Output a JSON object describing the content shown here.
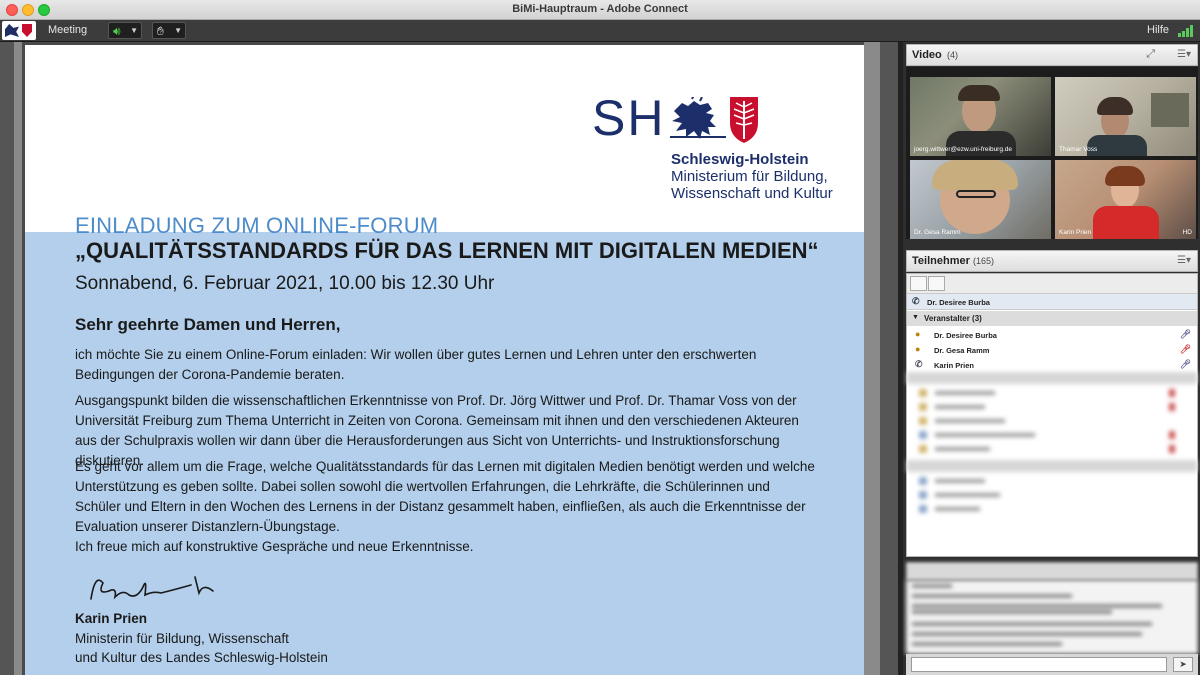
{
  "window": {
    "title": "BiMi-Hauptraum - Adobe Connect"
  },
  "toolbar": {
    "meeting_label": "Meeting",
    "help_label": "Hilfe"
  },
  "document": {
    "logo_text": "SH",
    "state_name": "Schleswig-Holstein",
    "ministry_line1": "Ministerium für Bildung,",
    "ministry_line2": "Wissenschaft und Kultur",
    "invitation": "EINLADUNG ZUM ONLINE-FORUM",
    "headline": "„QUALITÄTSSTANDARDS FÜR DAS LERNEN MIT DIGITALEN MEDIEN“",
    "datetime": "Sonnabend, 6. Februar 2021, 10.00 bis 12.30 Uhr",
    "salutation": "Sehr geehrte Damen und Herren,",
    "paragraph1": "ich möchte Sie zu einem Online-Forum einladen: Wir wollen über gutes Lernen und Lehren unter den erschwerten Bedingungen der Corona-Pandemie beraten.",
    "paragraph2": "Ausgangspunkt bilden die wissenschaftlichen Erkenntnisse von Prof. Dr. Jörg Wittwer und Prof. Dr. Thamar Voss von der Universität Freiburg zum Thema Unterricht in Zeiten von Corona. Gemeinsam mit ihnen und den verschiedenen Akteuren aus der Schulpraxis wollen wir dann über die Herausforderungen aus Sicht von Unterrichts- und Instruktionsforschung diskutieren.",
    "paragraph3": "Es geht vor allem um die Frage, welche Qualitätsstandards für das Lernen mit digitalen Medien benötigt werden und welche Unterstützung es geben sollte. Dabei sollen sowohl die wertvollen Erfahrungen, die Lehrkräfte, die Schülerinnen und Schüler und Eltern in den Wochen des Lernens in der Distanz gesammelt haben, einfließen, als auch die Erkenntnisse der Evaluation unserer Distanzlern-Übungstage.",
    "paragraph4": "Ich freue mich auf konstruktive Gespräche und neue Erkenntnisse.",
    "signer_name": "Karin Prien",
    "signer_role1": "Ministerin für Bildung, Wissenschaft",
    "signer_role2": "und Kultur des Landes Schleswig-Holstein"
  },
  "video_pod": {
    "title": "Video",
    "count": "(4)",
    "tiles": [
      {
        "label": "joerg.wittwer@ezw.uni-freiburg.de",
        "hd": ""
      },
      {
        "label": "Thamar Voss",
        "hd": ""
      },
      {
        "label": "Dr. Gesa Ramm",
        "hd": ""
      },
      {
        "label": "Karin Prien",
        "hd": "HD"
      }
    ]
  },
  "participants_pod": {
    "title": "Teilnehmer",
    "count": "(165)",
    "active_speaker": "Dr. Desiree Burba",
    "host_group": "Veranstalter (3)",
    "hosts": [
      {
        "name": "Dr. Desiree Burba"
      },
      {
        "name": "Dr. Gesa Ramm"
      },
      {
        "name": "Karin Prien"
      }
    ]
  },
  "icons": {
    "audio": "speaker-icon",
    "raise_hand": "hand-icon",
    "signal": "signal-bars-icon",
    "menu": "menu-icon"
  },
  "colors": {
    "ministry_blue": "#1c2f6b",
    "doc_panel_blue": "#b3cfeb",
    "invitation_blue": "#4d8ccb",
    "state_red": "#c8102e"
  }
}
